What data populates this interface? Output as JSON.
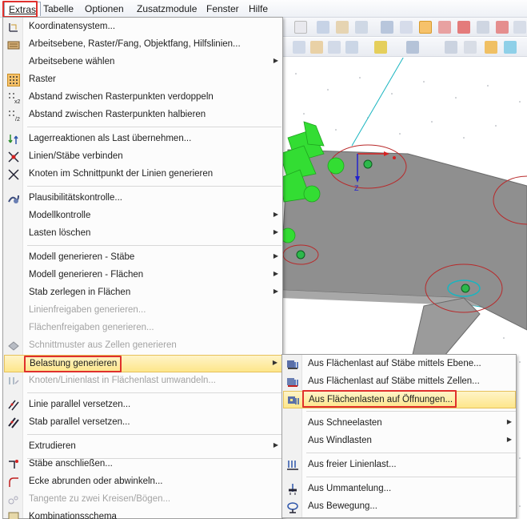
{
  "menubar": {
    "items": [
      {
        "label": "Extras"
      },
      {
        "label": "Tabelle"
      },
      {
        "label": "Optionen"
      },
      {
        "label": "Zusatzmodule"
      },
      {
        "label": "Fenster"
      },
      {
        "label": "Hilfe"
      }
    ]
  },
  "extras_menu": {
    "items": [
      {
        "label": "Koordinatensystem...",
        "icon": "coordinate-system-icon"
      },
      {
        "label": "Arbeitsebene, Raster/Fang, Objektfang, Hilfslinien...",
        "icon": "work-plane-icon"
      },
      {
        "label": "Arbeitsebene wählen",
        "submenu": true
      },
      {
        "label": "Raster",
        "icon": "grid-icon",
        "checked": true
      },
      {
        "label": "Abstand zwischen Rasterpunkten verdoppeln",
        "icon": "grid-double-icon"
      },
      {
        "label": "Abstand zwischen Rasterpunkten halbieren",
        "icon": "grid-half-icon"
      },
      {
        "label": "Lagerreaktionen als Last übernehmen...",
        "icon": "support-reactions-icon"
      },
      {
        "label": "Linien/Stäbe verbinden",
        "icon": "connect-lines-icon"
      },
      {
        "label": "Knoten im Schnittpunkt der Linien generieren",
        "icon": "intersection-node-icon"
      },
      {
        "label": "Plausibilitätskontrolle...",
        "icon": "plausibility-check-icon"
      },
      {
        "label": "Modellkontrolle",
        "submenu": true
      },
      {
        "label": "Lasten löschen",
        "submenu": true
      },
      {
        "label": "Modell generieren - Stäbe",
        "submenu": true
      },
      {
        "label": "Modell generieren - Flächen",
        "submenu": true
      },
      {
        "label": "Stab zerlegen in Flächen",
        "submenu": true
      },
      {
        "label": "Linienfreigaben generieren...",
        "disabled": true
      },
      {
        "label": "Flächenfreigaben generieren...",
        "disabled": true
      },
      {
        "label": "Schnittmuster aus Zellen generieren",
        "disabled": true,
        "icon": "cutting-pattern-icon"
      },
      {
        "label": "Belastung generieren",
        "submenu": true,
        "highlighted": true
      },
      {
        "label": "Knoten/Linienlast in Flächenlast umwandeln...",
        "disabled": true,
        "icon": "convert-load-icon"
      },
      {
        "label": "Linie parallel versetzen...",
        "icon": "offset-line-icon"
      },
      {
        "label": "Stab parallel versetzen...",
        "icon": "offset-member-icon"
      },
      {
        "label": "Extrudieren",
        "submenu": true
      },
      {
        "label": "Stäbe anschließen...",
        "icon": "connect-members-icon"
      },
      {
        "label": "Ecke abrunden oder abwinkeln...",
        "icon": "round-corner-icon"
      },
      {
        "label": "Tangente zu zwei Kreisen/Bögen...",
        "disabled": true,
        "icon": "tangent-icon"
      },
      {
        "label": "Kombinationsschema",
        "icon": "combination-icon"
      }
    ]
  },
  "belastung_submenu": {
    "items": [
      {
        "label": "Aus Flächenlast auf Stäbe mittels Ebene...",
        "icon": "area-load-plane-icon"
      },
      {
        "label": "Aus Flächenlast auf Stäbe mittels Zellen...",
        "icon": "area-load-cells-icon"
      },
      {
        "label": "Aus Flächenlasten auf Öffnungen...",
        "icon": "area-load-openings-icon",
        "highlighted": true
      },
      {
        "label": "Aus Schneelasten",
        "submenu": true
      },
      {
        "label": "Aus Windlasten",
        "submenu": true
      },
      {
        "label": "Aus freier Linienlast...",
        "icon": "free-line-load-icon"
      },
      {
        "label": "Aus Ummantelung...",
        "icon": "encasement-icon"
      },
      {
        "label": "Aus Bewegung...",
        "icon": "motion-icon"
      }
    ]
  },
  "viewport": {
    "axis_label": "Z"
  },
  "colors": {
    "highlight_red": "#e0302c",
    "menu_highlight": "#fde68a",
    "slab": "#8c8c8c",
    "support_green": "#33dd33"
  }
}
